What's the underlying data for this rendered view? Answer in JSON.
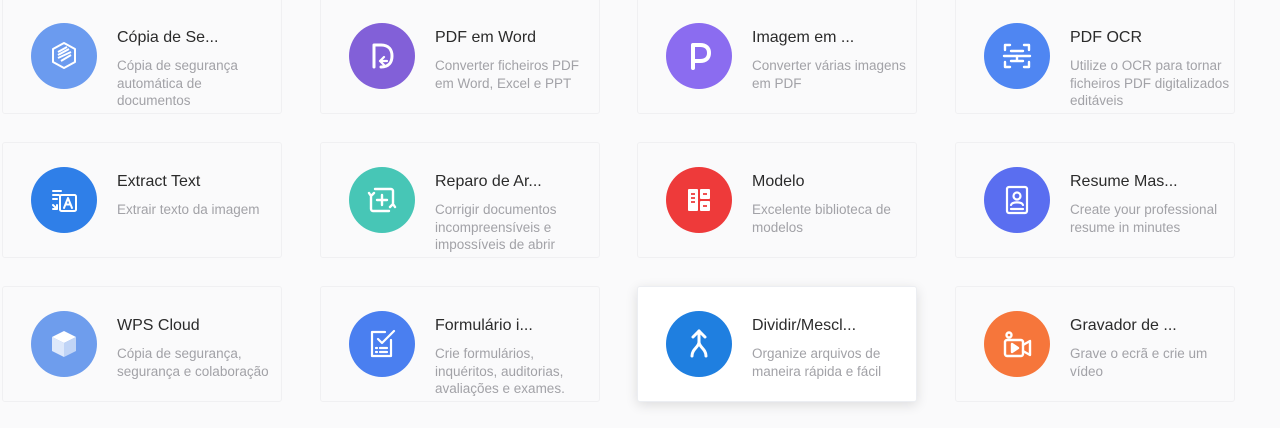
{
  "cards": [
    {
      "title": "Cópia de Se...",
      "desc": "Cópia de segurança automática de documentos",
      "icon": "cube-backup-icon",
      "color": "#6b9bef"
    },
    {
      "title": "PDF em Word",
      "desc": "Converter ficheiros PDF em Word, Excel e PPT",
      "icon": "pdf-to-word-icon",
      "color": "#8260d8"
    },
    {
      "title": "Imagem em ...",
      "desc": "Converter várias imagens em PDF",
      "icon": "image-to-pdf-icon",
      "color": "#8b6cf0"
    },
    {
      "title": "PDF OCR",
      "desc": "Utilize o OCR para tornar ficheiros PDF digitalizados editáveis",
      "icon": "ocr-scan-icon",
      "color": "#4f86f2"
    },
    {
      "title": "Extract Text",
      "desc": "Extrair texto da imagem",
      "icon": "extract-text-icon",
      "color": "#2f7fe8"
    },
    {
      "title": "Reparo de Ar...",
      "desc": "Corrigir documentos incompreensíveis e impossíveis de abrir",
      "icon": "file-repair-icon",
      "color": "#47c6b6"
    },
    {
      "title": "Modelo",
      "desc": "Excelente biblioteca de modelos",
      "icon": "template-icon",
      "color": "#ee3a3a"
    },
    {
      "title": "Resume Mas...",
      "desc": "Create your professional resume in minutes",
      "icon": "resume-icon",
      "color": "#5a6ef0"
    },
    {
      "title": "WPS Cloud",
      "desc": "Cópia de segurança, segurança e colaboração",
      "icon": "cloud-cube-icon",
      "color": "#6e9ded"
    },
    {
      "title": "Formulário i...",
      "desc": "Crie formulários, inquéritos, auditorias, avaliações e exames.",
      "icon": "form-checklist-icon",
      "color": "#4a7ff0"
    },
    {
      "title": "Dividir/Mescl...",
      "desc": "Organize arquivos de maneira rápida e fácil",
      "icon": "split-merge-icon",
      "color": "#1f7fe0"
    },
    {
      "title": "Gravador de ...",
      "desc": "Grave o ecrã e crie um vídeo",
      "icon": "screen-recorder-icon",
      "color": "#f6763b"
    }
  ]
}
